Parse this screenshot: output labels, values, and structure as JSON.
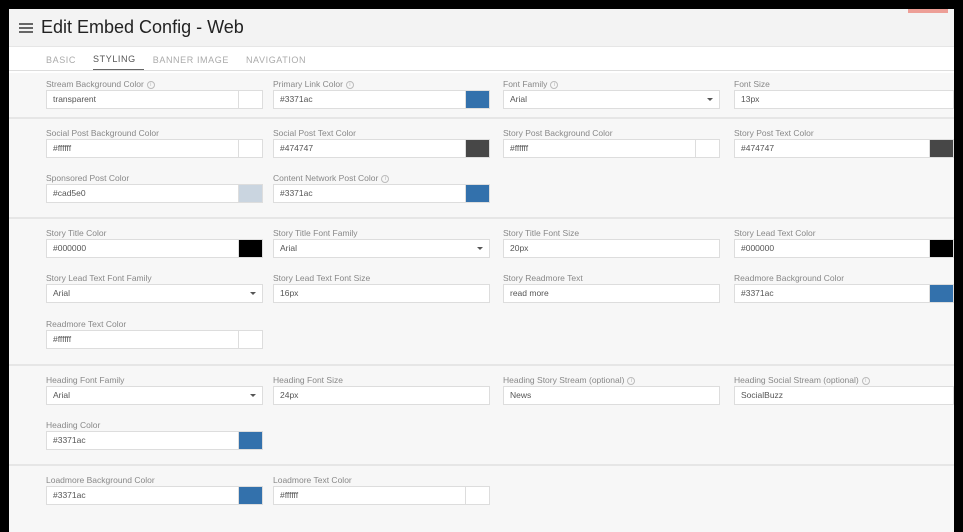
{
  "header": {
    "title": "Edit Embed Config - Web"
  },
  "tabs": [
    {
      "label": "BASIC",
      "active": false
    },
    {
      "label": "STYLING",
      "active": true
    },
    {
      "label": "BANNER IMAGE",
      "active": false
    },
    {
      "label": "NAVIGATION",
      "active": false
    }
  ],
  "colors": {
    "accent": "#3371ac",
    "dark": "#474747",
    "black": "#000000",
    "grey": "#cad5e0"
  },
  "fields": {
    "stream_bg": {
      "label": "Stream Background Color",
      "value": "transparent",
      "swatch": "#ffffff"
    },
    "primary_link": {
      "label": "Primary Link Color",
      "value": "#3371ac",
      "swatch": "#3371ac"
    },
    "font_family": {
      "label": "Font Family",
      "value": "Arial"
    },
    "font_size": {
      "label": "Font Size",
      "value": "13px"
    },
    "social_post_bg": {
      "label": "Social Post Background Color",
      "value": "#ffffff",
      "swatch": "#ffffff"
    },
    "social_post_text": {
      "label": "Social Post Text Color",
      "value": "#474747",
      "swatch": "#474747"
    },
    "story_post_bg": {
      "label": "Story Post Background Color",
      "value": "#ffffff",
      "swatch": "#ffffff"
    },
    "story_post_text": {
      "label": "Story Post Text Color",
      "value": "#474747",
      "swatch": "#474747"
    },
    "sponsored_post": {
      "label": "Sponsored Post Color",
      "value": "#cad5e0",
      "swatch": "#cad5e0"
    },
    "content_network_post": {
      "label": "Content Network Post Color",
      "value": "#3371ac",
      "swatch": "#3371ac"
    },
    "story_title_color": {
      "label": "Story Title Color",
      "value": "#000000",
      "swatch": "#000000"
    },
    "story_title_font_family": {
      "label": "Story Title Font Family",
      "value": "Arial"
    },
    "story_title_font_size": {
      "label": "Story Title Font Size",
      "value": "20px"
    },
    "story_lead_text_color": {
      "label": "Story Lead Text Color",
      "value": "#000000",
      "swatch": "#000000"
    },
    "story_lead_font_family": {
      "label": "Story Lead Text Font Family",
      "value": "Arial"
    },
    "story_lead_font_size": {
      "label": "Story Lead Text Font Size",
      "value": "16px"
    },
    "story_readmore_text": {
      "label": "Story Readmore Text",
      "value": "read more"
    },
    "readmore_bg": {
      "label": "Readmore Background Color",
      "value": "#3371ac",
      "swatch": "#3371ac"
    },
    "readmore_text_color": {
      "label": "Readmore Text Color",
      "value": "#ffffff",
      "swatch": "#ffffff"
    },
    "heading_font_family": {
      "label": "Heading Font Family",
      "value": "Arial"
    },
    "heading_font_size": {
      "label": "Heading Font Size",
      "value": "24px"
    },
    "heading_story_stream": {
      "label": "Heading Story Stream (optional)",
      "value": "News"
    },
    "heading_social_stream": {
      "label": "Heading Social Stream (optional)",
      "value": "SocialBuzz"
    },
    "heading_color": {
      "label": "Heading Color",
      "value": "#3371ac",
      "swatch": "#3371ac"
    },
    "loadmore_bg": {
      "label": "Loadmore Background Color",
      "value": "#3371ac",
      "swatch": "#3371ac"
    },
    "loadmore_text": {
      "label": "Loadmore Text Color",
      "value": "#ffffff",
      "swatch": "#ffffff"
    }
  }
}
